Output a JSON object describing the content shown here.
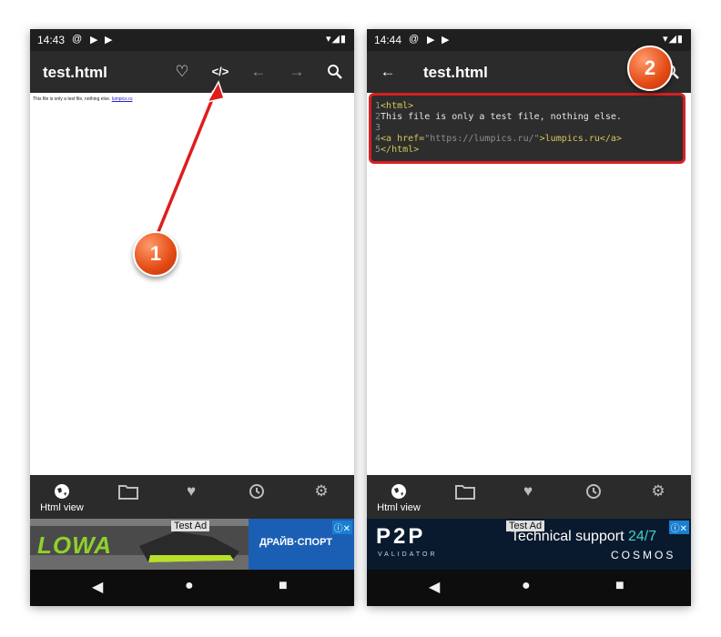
{
  "left": {
    "status_time": "14:43",
    "title": "test.html",
    "code_button": "</>",
    "preview_text": "This file is only a test file, nothing else.",
    "preview_link": "lumpics.ru",
    "nav_label": "Html view",
    "ad": {
      "test_label": "Test Ad",
      "brand": "LOWA",
      "shop": "ДРАЙВ·СПОРТ"
    }
  },
  "right": {
    "status_time": "14:44",
    "title": "test.html",
    "code_lines": [
      {
        "num": "1",
        "text": "<html>"
      },
      {
        "num": "2",
        "text": "This file is only a test file, nothing else."
      },
      {
        "num": "3",
        "text": ""
      },
      {
        "num": "4",
        "pre": "<a href=",
        "str": "\"https://lumpics.ru/\"",
        "post": ">lumpics.ru</a>"
      },
      {
        "num": "5",
        "text": "</html>"
      }
    ],
    "nav_label": "Html view",
    "ad": {
      "test_label": "Test Ad",
      "logo": "P2P",
      "logo_sub": "VALIDATOR",
      "headline_a": "Technical support ",
      "headline_b": "24/7",
      "brand": "COSMOS"
    }
  },
  "annotations": {
    "step1": "1",
    "step2": "2"
  },
  "colors": {
    "statusbar": "#1f1f1f",
    "appbar": "#2b2b2b",
    "highlight": "#d62020",
    "badge": "#e44a14"
  }
}
